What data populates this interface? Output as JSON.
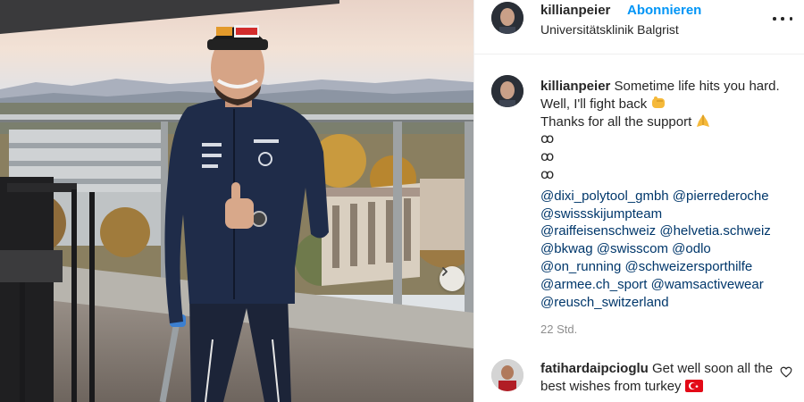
{
  "post": {
    "username": "killianpeier",
    "follow_label": "Abonnieren",
    "separator": "•",
    "location": "Universitätsklinik Balgrist",
    "more_icon": "more-horizontal-icon",
    "next_icon": "chevron-right-icon"
  },
  "caption": {
    "username": "killianpeier",
    "text_1": "Sometime life hits you hard. Well, I'll fight back",
    "emoji_1": "fist-bump-emoji",
    "text_2": "Thanks for all the support",
    "emoji_2": "folded-hands-emoji",
    "symbol_lines": [
      "ꝏ",
      "ꝏ",
      "ꝏ"
    ],
    "mentions": [
      "@dixi_polytool_gmbh @pierrederoche",
      "@swissskijumpteam",
      "@raiffeisenschweiz @helvetia.schweiz",
      "@bkwag @swisscom @odlo",
      "@on_running @schweizersporthilfe",
      "@armee.ch_sport @wamsactivewear",
      "@reusch_switzerland"
    ],
    "time": "22 Std."
  },
  "comment": {
    "username": "fatihardaipcioglu",
    "text": "Get well soon all the best wishes from turkey",
    "flag": "turkey-flag-emoji",
    "like_icon": "heart-icon"
  },
  "colors": {
    "link_blue": "#0095f6",
    "mention_blue": "#00376b",
    "muted": "#8e8e8e",
    "jacket": "#1f2c49"
  }
}
